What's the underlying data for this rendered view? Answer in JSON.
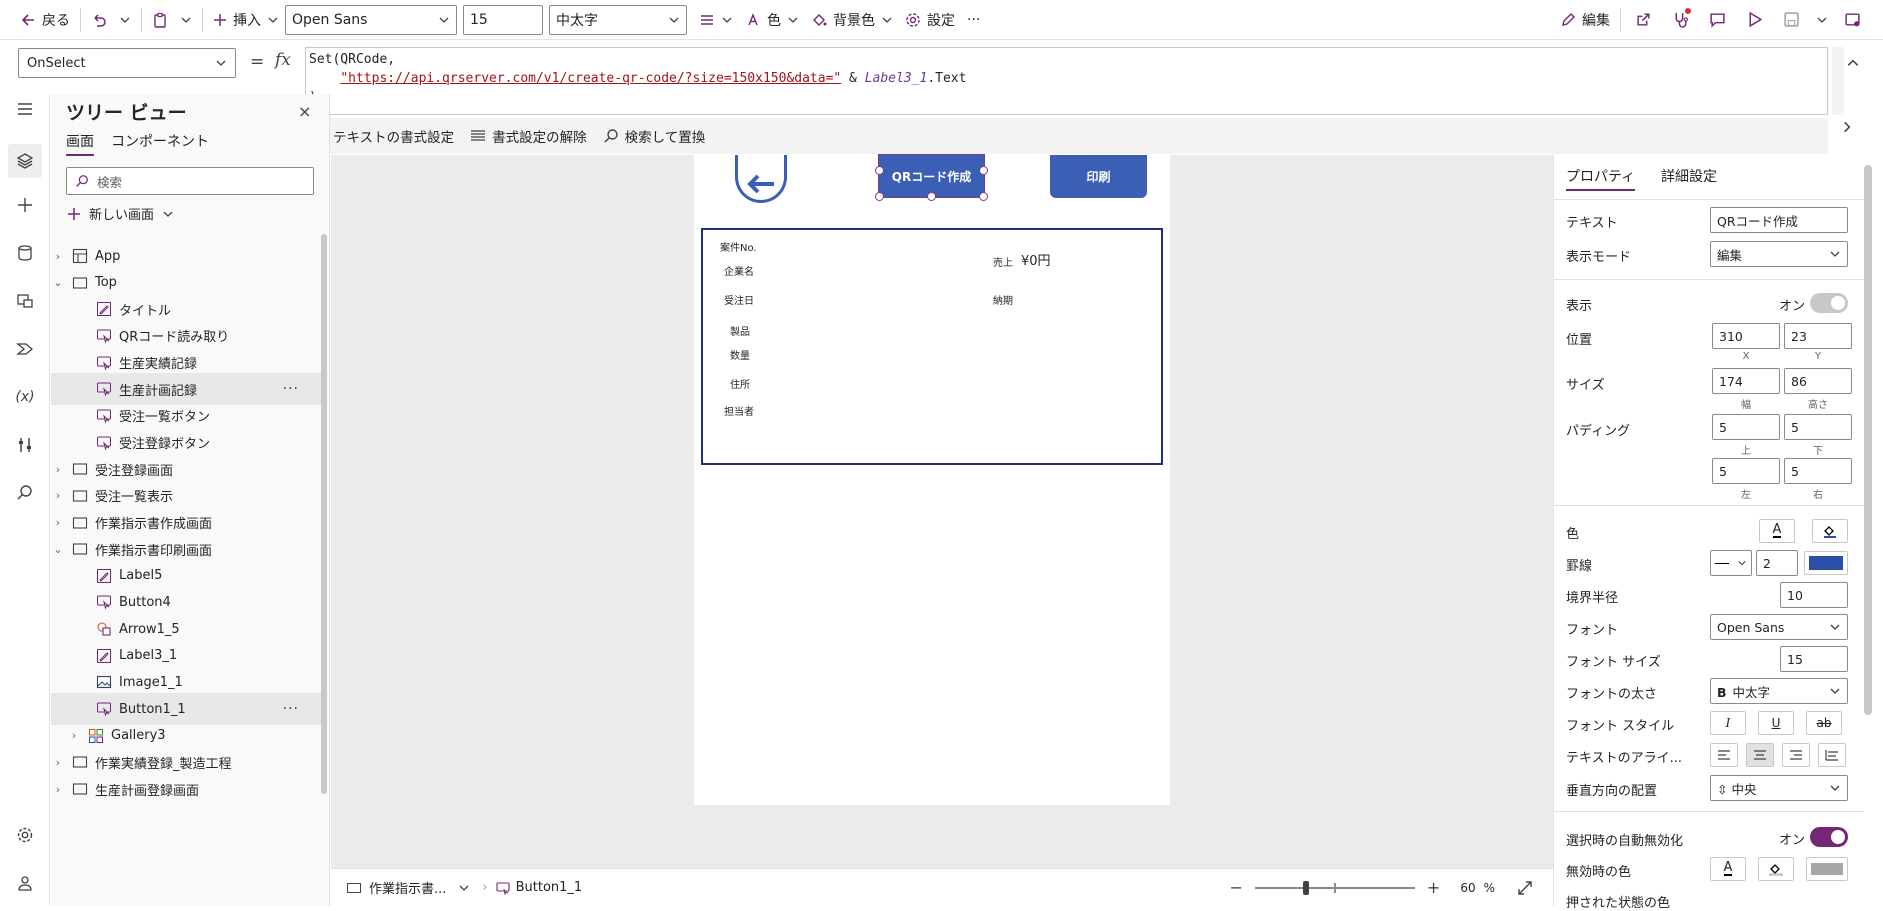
{
  "toolbar": {
    "back": "戻る",
    "insert": "挿入",
    "font": "Open Sans",
    "font_size": "15",
    "font_weight": "中太字",
    "color": "色",
    "background": "背景色",
    "settings": "設定",
    "more": "···",
    "edit": "編集"
  },
  "formula": {
    "property": "OnSelect",
    "fx": "fx",
    "equals": "=",
    "line1": "Set(QRCode,",
    "line2_indent": "    ",
    "line2_str": "\"https://api.qrserver.com/v1/create-qr-code/?size=150x150&data=\"",
    "line2_amp": " & ",
    "line2_var": "Label3_1",
    "line2_tail": ".Text",
    "line3": ")",
    "format_text": "テキストの書式設定",
    "remove_format": "書式設定の解除",
    "find_replace": "検索して置換"
  },
  "tree": {
    "title": "ツリー ビュー",
    "tab_screens": "画面",
    "tab_components": "コンポーネント",
    "search_placeholder": "検索",
    "new_screen": "新しい画面",
    "items": [
      {
        "label": "App",
        "icon": "app-icon",
        "chev": "›"
      },
      {
        "label": "Top",
        "icon": "screen-icon",
        "chev": "⌄"
      },
      {
        "label": "タイトル",
        "icon": "label-icon",
        "chev": ""
      },
      {
        "label": "QRコード読み取り",
        "icon": "button-icon",
        "chev": ""
      },
      {
        "label": "生産実績記録",
        "icon": "button-icon",
        "chev": ""
      },
      {
        "label": "生産計画記録",
        "icon": "button-icon",
        "chev": "",
        "selected": true,
        "dots": "···"
      },
      {
        "label": "受注一覧ボタン",
        "icon": "button-icon",
        "chev": ""
      },
      {
        "label": "受注登録ボタン",
        "icon": "button-icon",
        "chev": ""
      },
      {
        "label": "受注登録画面",
        "icon": "screen-icon",
        "chev": "›"
      },
      {
        "label": "受注一覧表示",
        "icon": "screen-icon",
        "chev": "›"
      },
      {
        "label": "作業指示書作成画面",
        "icon": "screen-icon",
        "chev": "›"
      },
      {
        "label": "作業指示書印刷画面",
        "icon": "screen-icon",
        "chev": "⌄"
      },
      {
        "label": "Label5",
        "icon": "label-icon",
        "chev": ""
      },
      {
        "label": "Button4",
        "icon": "button-icon",
        "chev": ""
      },
      {
        "label": "Arrow1_5",
        "icon": "shape-icon",
        "chev": ""
      },
      {
        "label": "Label3_1",
        "icon": "label-icon",
        "chev": ""
      },
      {
        "label": "Image1_1",
        "icon": "image-icon",
        "chev": ""
      },
      {
        "label": "Button1_1",
        "icon": "button-icon",
        "chev": "",
        "selected": true,
        "dots": "···"
      },
      {
        "label": "Gallery3",
        "icon": "gallery-icon",
        "chev": "›"
      },
      {
        "label": "作業実績登録_製造工程",
        "icon": "screen-icon",
        "chev": "›"
      },
      {
        "label": "生産計画登録画面",
        "icon": "screen-icon",
        "chev": "›"
      }
    ]
  },
  "canvas": {
    "qr_button": "QRコード作成",
    "print_button": "印刷",
    "form": {
      "case_no": "案件No.",
      "company": "企業名",
      "order_date": "受注日",
      "product": "製品",
      "quantity": "数量",
      "address": "住所",
      "person": "担当者",
      "sales": "売上",
      "sales_value": "¥0円",
      "delivery": "納期"
    }
  },
  "props": {
    "tab_properties": "プロパティ",
    "tab_advanced": "詳細設定",
    "text_label": "テキスト",
    "text_value": "QRコード作成",
    "display_mode_label": "表示モード",
    "display_mode_value": "編集",
    "visible_label": "表示",
    "visible_value": "オン",
    "position_label": "位置",
    "pos_x": "310",
    "pos_y": "23",
    "pos_x_sub": "X",
    "pos_y_sub": "Y",
    "size_label": "サイズ",
    "width": "174",
    "height": "86",
    "width_sub": "幅",
    "height_sub": "高さ",
    "padding_label": "パディング",
    "pad_top": "5",
    "pad_bottom": "5",
    "pad_left": "5",
    "pad_right": "5",
    "pad_top_sub": "上",
    "pad_bottom_sub": "下",
    "pad_left_sub": "左",
    "pad_right_sub": "右",
    "color_label": "色",
    "border_label": "罫線",
    "border_width": "2",
    "border_color": "#2b4fa8",
    "radius_label": "境界半径",
    "radius_value": "10",
    "font_label": "フォント",
    "font_value": "Open Sans",
    "font_size_label": "フォント サイズ",
    "font_size_value": "15",
    "font_weight_label": "フォントの太さ",
    "font_weight_value": "中太字",
    "font_style_label": "フォント スタイル",
    "text_align_label": "テキストのアライ...",
    "vertical_align_label": "垂直方向の配置",
    "vertical_align_value": "中央",
    "auto_disable_label": "選択時の自動無効化",
    "auto_disable_value": "オン",
    "disabled_color_label": "無効時の色",
    "pressed_color_label": "押された状態の色"
  },
  "bottom": {
    "screen_crumb": "作業指示書...",
    "control_crumb": "Button1_1",
    "zoom": "60",
    "zoom_unit": "%"
  },
  "colors": {
    "accent": "#742774",
    "button_blue": "#3a5fb5",
    "form_border": "#1f2f7a"
  }
}
